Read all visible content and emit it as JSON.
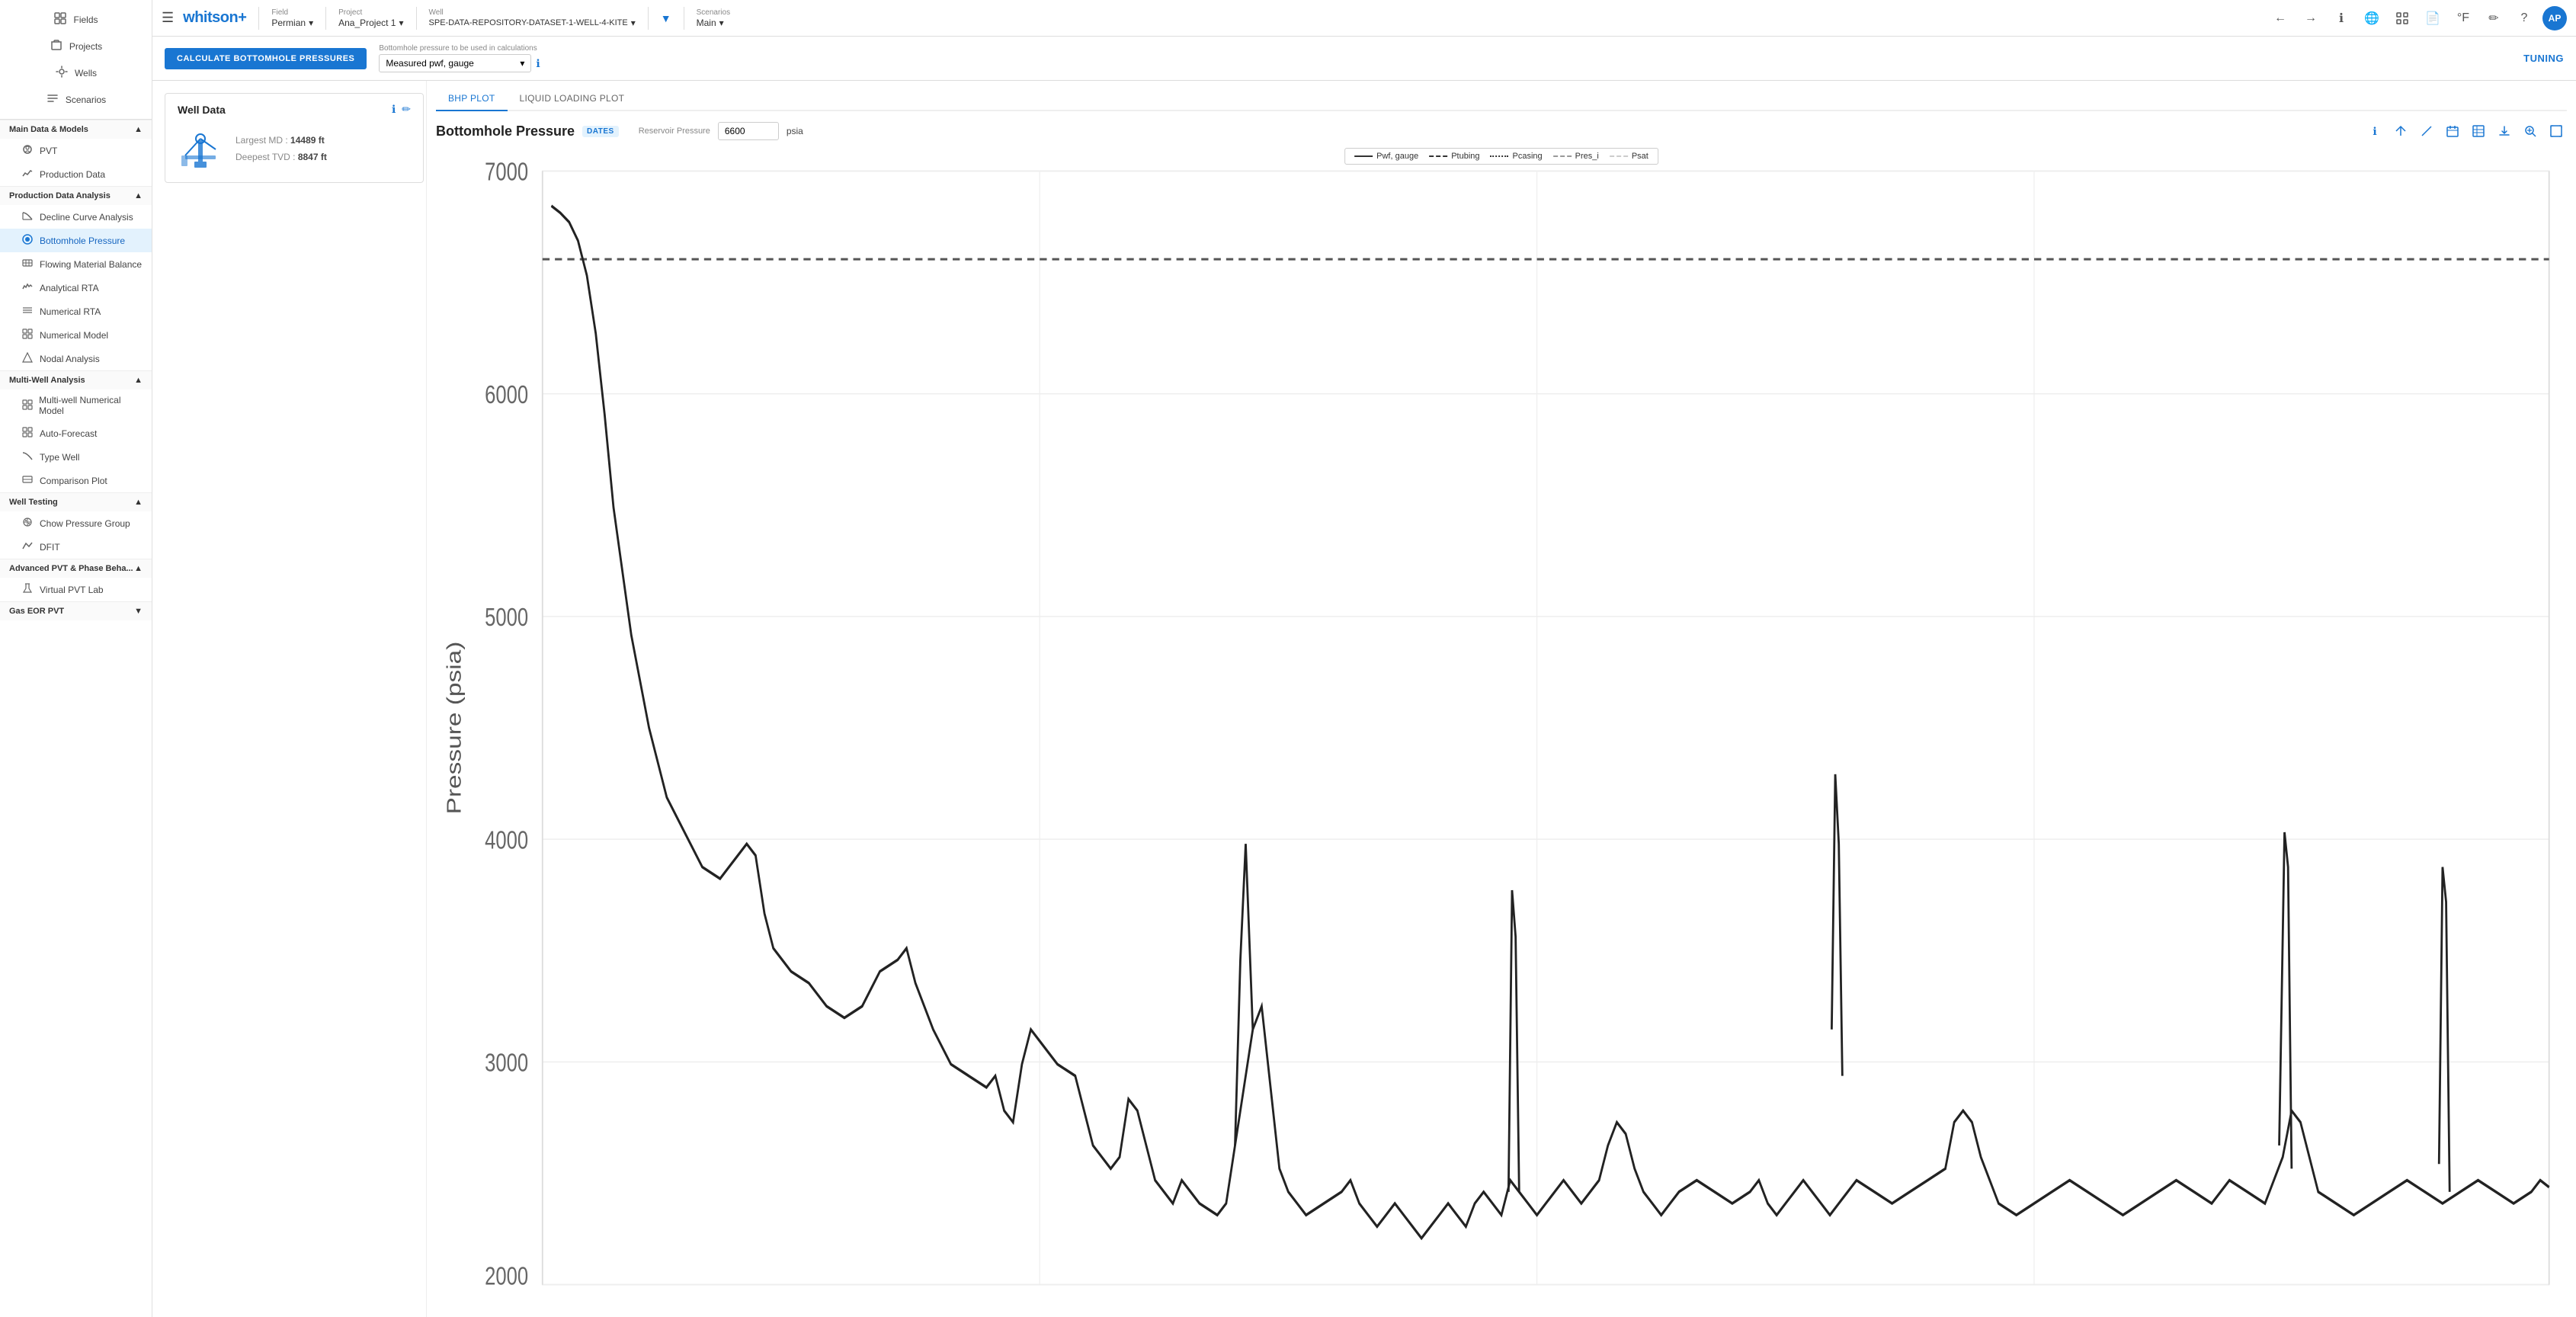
{
  "topbar": {
    "brand": "whitson",
    "brand_plus": "+",
    "field_label": "Field",
    "field_value": "Permian",
    "project_label": "Project",
    "project_value": "Ana_Project 1",
    "well_label": "Well",
    "well_value": "SPE-DATA-REPOSITORY-DATASET-1-WELL-4-KITE",
    "scenarios_label": "Scenarios",
    "scenarios_value": "Main",
    "avatar": "AP"
  },
  "sidebar": {
    "top_items": [
      {
        "name": "fields",
        "label": "Fields",
        "icon": "⊞"
      },
      {
        "name": "projects",
        "label": "Projects",
        "icon": "📁"
      },
      {
        "name": "wells",
        "label": "Wells",
        "icon": "⛽"
      },
      {
        "name": "scenarios",
        "label": "Scenarios",
        "icon": "📋"
      }
    ],
    "main_data_models": {
      "header": "Main Data & Models",
      "items": [
        {
          "name": "pvt",
          "label": "PVT",
          "icon": "👤"
        },
        {
          "name": "production-data",
          "label": "Production Data",
          "icon": "📈"
        }
      ]
    },
    "production_data_analysis": {
      "header": "Production Data Analysis",
      "items": [
        {
          "name": "decline-curve",
          "label": "Decline Curve Analysis",
          "icon": "📉"
        },
        {
          "name": "bottomhole-pressure",
          "label": "Bottomhole Pressure",
          "icon": "🔵",
          "active": true
        },
        {
          "name": "flowing-material-balance",
          "label": "Flowing Material Balance",
          "icon": "📊"
        },
        {
          "name": "analytical-rta",
          "label": "Analytical RTA",
          "icon": "〰"
        },
        {
          "name": "numerical-rta",
          "label": "Numerical RTA",
          "icon": "≡"
        },
        {
          "name": "numerical-model",
          "label": "Numerical Model",
          "icon": "▦"
        },
        {
          "name": "nodal-analysis",
          "label": "Nodal Analysis",
          "icon": "⬡"
        }
      ]
    },
    "multi_well": {
      "header": "Multi-Well Analysis",
      "items": [
        {
          "name": "multi-well-numerical",
          "label": "Multi-well Numerical Model",
          "icon": "▦"
        },
        {
          "name": "auto-forecast",
          "label": "Auto-Forecast",
          "icon": "⊞"
        },
        {
          "name": "type-well",
          "label": "Type Well",
          "icon": "📉"
        },
        {
          "name": "comparison-plot",
          "label": "Comparison Plot",
          "icon": "📊"
        }
      ]
    },
    "well_testing": {
      "header": "Well Testing",
      "items": [
        {
          "name": "chow-pressure-group",
          "label": "Chow Pressure Group",
          "icon": "⊕"
        },
        {
          "name": "dfit",
          "label": "DFIT",
          "icon": "📉"
        }
      ]
    },
    "advanced_pvt": {
      "header": "Advanced PVT & Phase Beha...",
      "items": [
        {
          "name": "virtual-pvt-lab",
          "label": "Virtual PVT Lab",
          "icon": "🔬"
        }
      ]
    },
    "gas_eor_pvt": {
      "header": "Gas EOR PVT",
      "items": []
    }
  },
  "action_bar": {
    "calculate_btn": "CALCULATE BOTTOMHOLE PRESSURES",
    "bhp_label": "Bottomhole pressure to be used in calculations",
    "bhp_value": "Measured pwf, gauge",
    "tuning": "TUNING"
  },
  "well_data": {
    "title": "Well Data",
    "largest_md_label": "Largest MD :",
    "largest_md_value": "14489 ft",
    "deepest_tvd_label": "Deepest TVD :",
    "deepest_tvd_value": "8847 ft"
  },
  "bhp": {
    "tabs": [
      {
        "label": "BHP PLOT",
        "active": true
      },
      {
        "label": "LIQUID LOADING PLOT",
        "active": false
      }
    ],
    "chart_title": "Bottomhole Pressure",
    "dates_badge": "DATES",
    "reservoir_pressure_label": "Reservoir Pressure",
    "reservoir_pressure_value": "6600",
    "reservoir_pressure_unit": "psia",
    "legend": [
      {
        "label": "Pwf, gauge",
        "line": "solid"
      },
      {
        "label": "Ptubing",
        "line": "dashed"
      },
      {
        "label": "Pcasing",
        "line": "dotted"
      },
      {
        "label": "Pres_i",
        "line": "dash"
      },
      {
        "label": "Psat",
        "line": "dash-light"
      }
    ],
    "y_axis_label": "Pressure (psia)",
    "y_ticks": [
      "7000",
      "6000",
      "5000",
      "4000",
      "3000",
      "2000"
    ],
    "chart_actions": [
      {
        "name": "info",
        "icon": "ℹ"
      },
      {
        "name": "zoom-reset",
        "icon": "↗"
      },
      {
        "name": "line-tool",
        "icon": "⟋"
      },
      {
        "name": "calendar",
        "icon": "📅"
      },
      {
        "name": "data-table",
        "icon": "⊞"
      },
      {
        "name": "download",
        "icon": "⬇"
      },
      {
        "name": "zoom-in",
        "icon": "🔍"
      },
      {
        "name": "expand",
        "icon": "⛶"
      }
    ]
  }
}
